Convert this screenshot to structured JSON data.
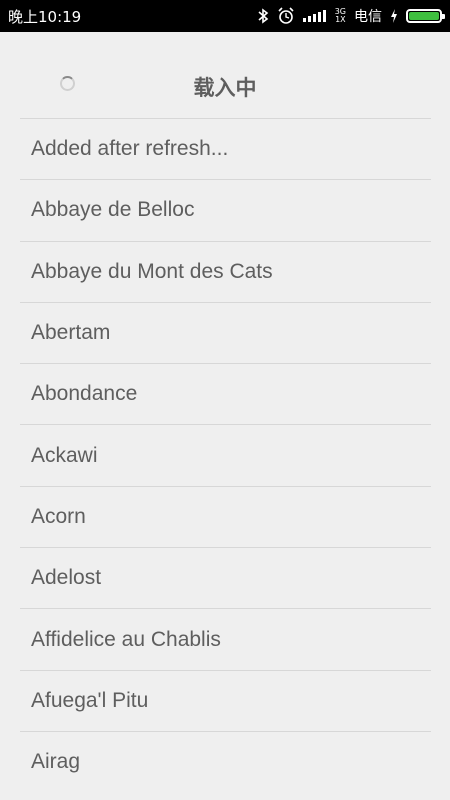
{
  "status_bar": {
    "time": "晚上10:19",
    "network_top": "3G",
    "network_bottom": "1X",
    "carrier": "电信",
    "battery_level": 1.0,
    "battery_color": "#3fbf3f"
  },
  "header": {
    "loading_text": "载入中"
  },
  "list": {
    "items": [
      "Added after refresh...",
      "Abbaye de Belloc",
      "Abbaye du Mont des Cats",
      "Abertam",
      "Abondance",
      "Ackawi",
      "Acorn",
      "Adelost",
      "Affidelice au Chablis",
      "Afuega'l Pitu",
      "Airag"
    ]
  },
  "icons": [
    "bluetooth-icon",
    "alarm-icon",
    "signal-icon",
    "charging-icon",
    "battery-icon"
  ]
}
